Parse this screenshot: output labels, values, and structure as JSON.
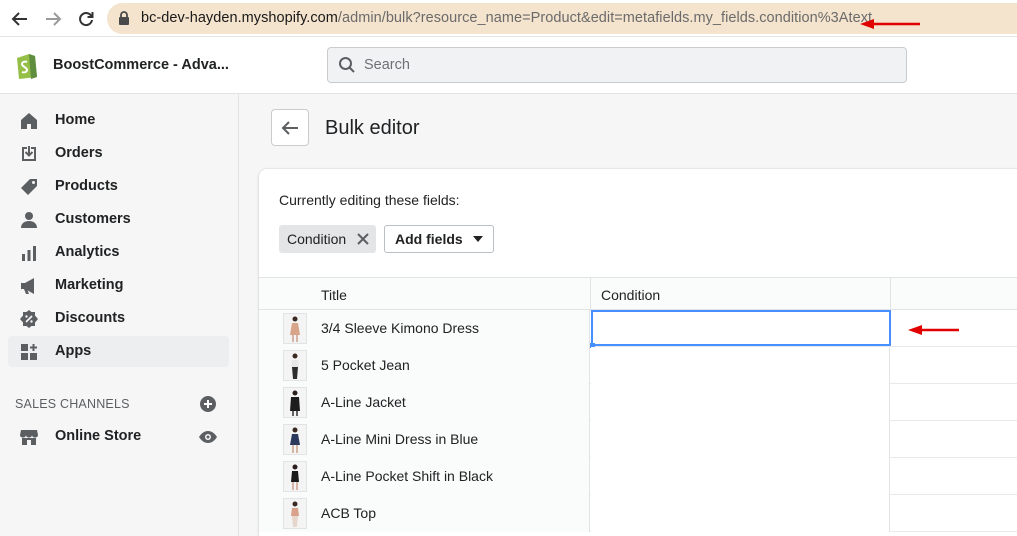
{
  "browser": {
    "url_host": "bc-dev-hayden.myshopify.com",
    "url_path": "/admin/bulk?resource_name=Product&edit=metafields.my_fields.condition%3Atext"
  },
  "topbar": {
    "store_name": "BoostCommerce - Adva...",
    "search_placeholder": "Search"
  },
  "sidebar": {
    "items": [
      {
        "label": "Home",
        "icon": "home-icon"
      },
      {
        "label": "Orders",
        "icon": "orders-icon"
      },
      {
        "label": "Products",
        "icon": "tag-icon"
      },
      {
        "label": "Customers",
        "icon": "person-icon"
      },
      {
        "label": "Analytics",
        "icon": "bar-chart-icon"
      },
      {
        "label": "Marketing",
        "icon": "megaphone-icon"
      },
      {
        "label": "Discounts",
        "icon": "discount-icon"
      },
      {
        "label": "Apps",
        "icon": "apps-icon"
      }
    ],
    "sales_channels_heading": "SALES CHANNELS",
    "channels": [
      {
        "label": "Online Store",
        "icon": "store-icon"
      }
    ]
  },
  "page": {
    "title": "Bulk editor",
    "editing_label": "Currently editing these fields:",
    "field_tag": "Condition",
    "add_fields_label": "Add fields"
  },
  "grid": {
    "columns": [
      "Title",
      "Condition"
    ],
    "rows": [
      {
        "title": "3/4 Sleeve Kimono Dress",
        "condition": "",
        "thumb_color": "#d8a48a"
      },
      {
        "title": "5 Pocket Jean",
        "condition": "",
        "thumb_color": "#2d2d2d"
      },
      {
        "title": "A-Line Jacket",
        "condition": "",
        "thumb_color": "#1c1c1c"
      },
      {
        "title": "A-Line Mini Dress in Blue",
        "condition": "",
        "thumb_color": "#2b3a5c"
      },
      {
        "title": "A-Line Pocket Shift in Black",
        "condition": "",
        "thumb_color": "#1a1a1a"
      },
      {
        "title": "ACB Top",
        "condition": "",
        "thumb_color": "#d9a08a"
      }
    ]
  },
  "colors": {
    "shopify_green": "#95bf47",
    "focus_blue": "#458fff",
    "annotation_red": "#e00000",
    "url_bar": "#f4e3cd"
  }
}
